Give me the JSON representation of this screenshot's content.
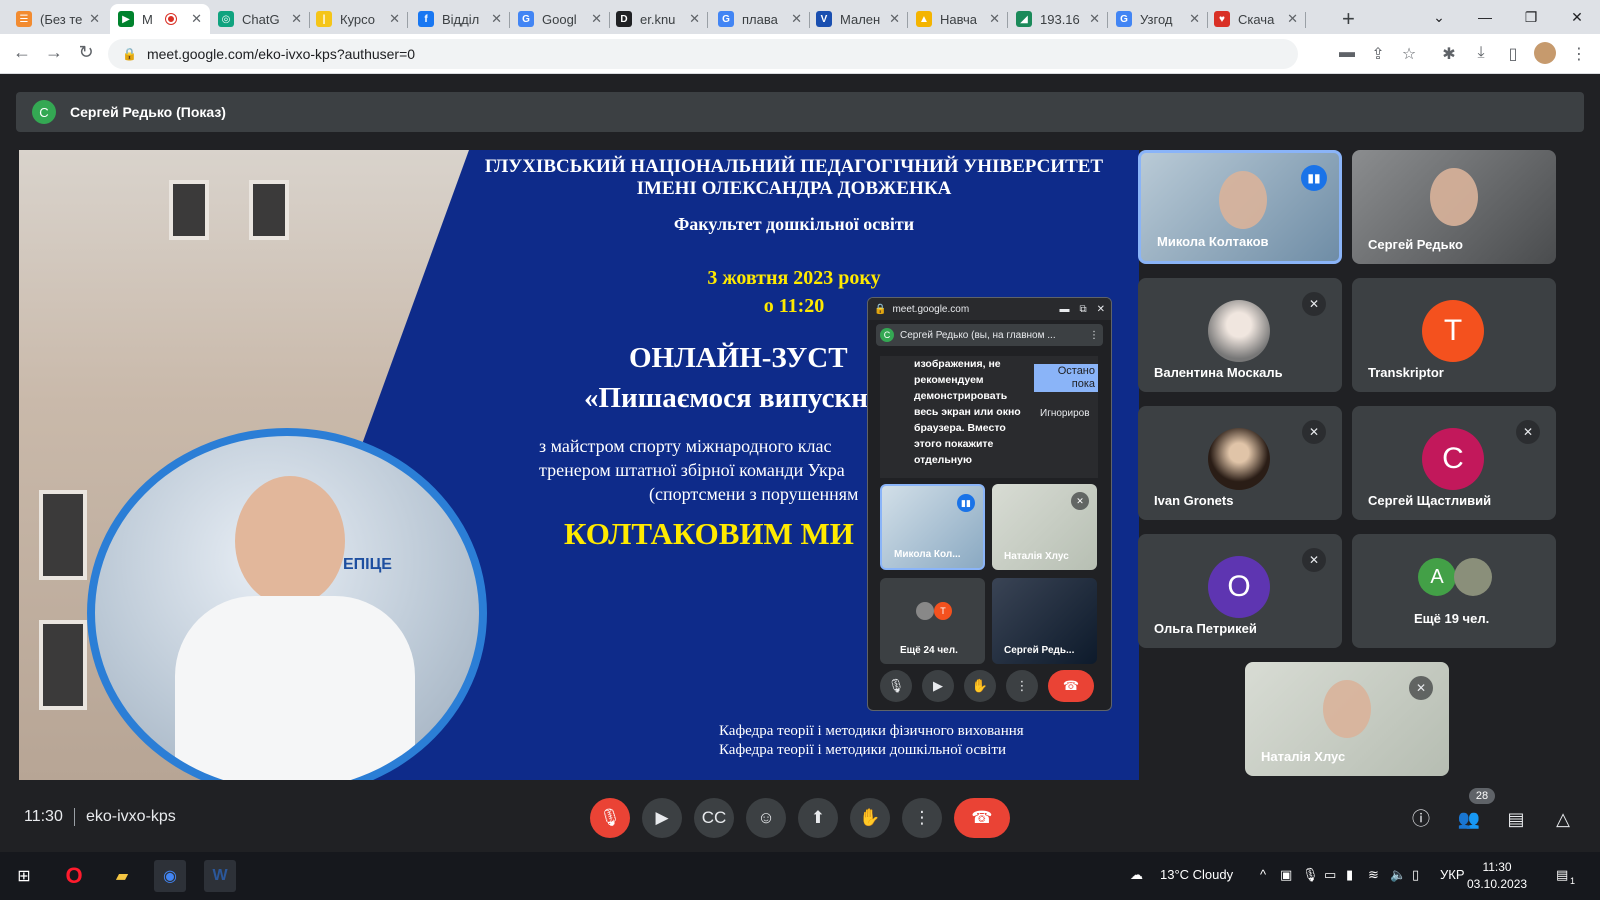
{
  "tabs": [
    {
      "title": "(Без те",
      "color": "#f28b30",
      "glyph": "☰"
    },
    {
      "title": "M",
      "color": "#00832d",
      "glyph": "▶"
    },
    {
      "title": "ChatG",
      "color": "#10a37f",
      "glyph": "◎"
    },
    {
      "title": "Курсо",
      "color": "#f5c518",
      "glyph": "|"
    },
    {
      "title": "Відділ",
      "color": "#1877f2",
      "glyph": "f"
    },
    {
      "title": "Googl",
      "color": "#4285f4",
      "glyph": "G"
    },
    {
      "title": "er.knu",
      "color": "#202124",
      "glyph": "D"
    },
    {
      "title": "плава",
      "color": "#4285f4",
      "glyph": "G"
    },
    {
      "title": "Мален",
      "color": "#1a4fb0",
      "glyph": "V"
    },
    {
      "title": "Навча",
      "color": "#f4b400",
      "glyph": "▲"
    },
    {
      "title": "193.16",
      "color": "#1b8a5a",
      "glyph": "◢"
    },
    {
      "title": "Узгод",
      "color": "#4285f4",
      "glyph": "G"
    },
    {
      "title": "Скача",
      "color": "#d93025",
      "glyph": "♥"
    }
  ],
  "address": {
    "url": "meet.google.com/eko-ivxo-kps?authuser=0"
  },
  "presenter": {
    "initial": "С",
    "label": "Сергей Редько (Показ)"
  },
  "slide": {
    "univ_line1": "ГЛУХІВСЬКИЙ НАЦІОНАЛЬНИЙ ПЕДАГОГІЧНИЙ УНІВЕРСИТЕТ",
    "univ_line2": "ІМЕНІ ОЛЕКСАНДРА ДОВЖЕНКА",
    "faculty": "Факультет дошкільної освіти",
    "date": "3 жовтня 2023 року",
    "time": "о 11:20",
    "title1": "ОНЛАЙН-ЗУСТ",
    "title2": "«Пишаємося випускн",
    "sub1": "з майстром спорту міжнародного клас",
    "sub2": "тренером штатної збірної команди Укра",
    "sub3": "(спортсмени з порушенням",
    "name": "КОЛТАКОВИМ МИ",
    "ring_sign": "ЕПІЦЕ",
    "dept1": "Кафедра теорії і методики фізичного виховання",
    "dept2": "Кафедра теорії і методики дошкільної освіти"
  },
  "pip": {
    "domain": "meet.google.com",
    "header": "Сергей Редько (вы, на главном ...",
    "header_initial": "С",
    "warn_text": "изображения, не рекомендуем демонстрировать весь экран или окно браузера. Вместо этого покажите отдельную",
    "stop_label": "Остано пока",
    "ignore_label": "Игнориров",
    "tile1": "Микола Кол...",
    "tile2": "Наталія Хлус",
    "tile3": "Ещё 24 чел.",
    "tile3_initial": "T",
    "tile4": "Сергей Редь..."
  },
  "participants": [
    {
      "name": "Микола Колтаков"
    },
    {
      "name": "Сергей Редько"
    },
    {
      "name": "Валентина Москаль"
    },
    {
      "name": "Transkriptor",
      "initial": "T",
      "color": "#f4511e"
    },
    {
      "name": "Ivan Gronets"
    },
    {
      "name": "Сергей Щастливий",
      "initial": "С",
      "color": "#c2185b"
    },
    {
      "name": "Ольга Петрикей",
      "initial": "О",
      "color": "#5e35b1"
    },
    {
      "name": "Ещё 19 чел.",
      "initial": "A",
      "color": "#43a047"
    },
    {
      "name": "Наталія Хлус"
    }
  ],
  "bottom": {
    "time": "11:30",
    "code": "eko-ivxo-kps",
    "people_count": "28"
  },
  "taskbar": {
    "weather": "13°C  Cloudy",
    "lang": "УКР",
    "clock_time": "11:30",
    "clock_date": "03.10.2023",
    "notif": "1"
  }
}
